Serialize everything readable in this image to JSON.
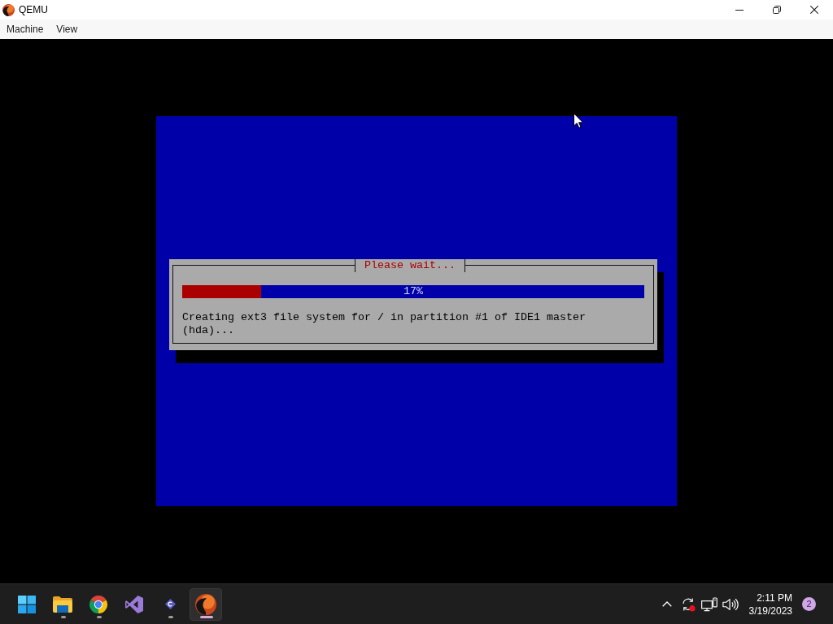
{
  "window": {
    "title": "QEMU",
    "menu": [
      {
        "label": "Machine"
      },
      {
        "label": "View"
      }
    ]
  },
  "installer": {
    "dialog": {
      "title": "Please wait...",
      "progress": {
        "level": 0.17,
        "label": "17%"
      },
      "message": "Creating ext3 file system for / in partition #1 of IDE1 master\n(hda)..."
    }
  },
  "taskbar": {
    "apps": [
      {
        "running": true,
        "selected": false
      },
      {
        "running": true,
        "selected": false
      },
      {
        "running": false,
        "selected": false
      },
      {
        "running": true,
        "selected": false
      },
      {
        "running": true,
        "selected": true
      }
    ],
    "clock": {
      "time": "2:11 PM",
      "date": "3/19/2023"
    },
    "notifications": "2"
  }
}
